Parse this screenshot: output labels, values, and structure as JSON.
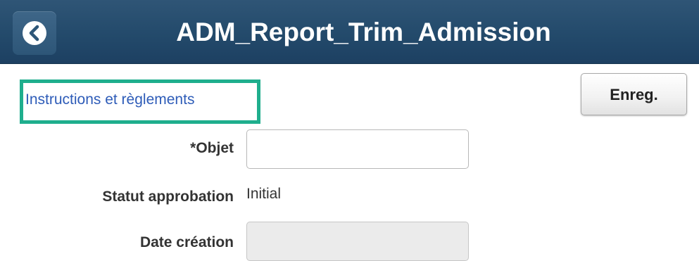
{
  "header": {
    "title": "ADM_Report_Trim_Admission",
    "back_icon": "chevron-left-icon"
  },
  "toolbar": {
    "save_label": "Enreg."
  },
  "instructions": {
    "link_text": "Instructions et règlements",
    "highlight_color": "#1fae8d"
  },
  "form": {
    "subject_label": "*Objet",
    "subject_value": "",
    "approval_status_label": "Statut approbation",
    "approval_status_value": "Initial",
    "creation_date_label": "Date création",
    "creation_date_value": ""
  },
  "colors": {
    "header_bg": "#234a6b",
    "link": "#2e5cb8"
  }
}
